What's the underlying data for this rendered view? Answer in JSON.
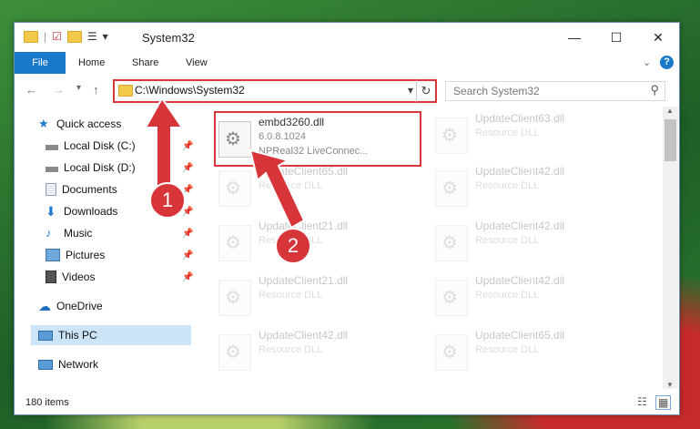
{
  "window": {
    "title": "System32"
  },
  "titlebar": {
    "minimize": "—",
    "maximize": "☐",
    "close": "✕",
    "qat_dropdown": "▾"
  },
  "ribbon": {
    "tabs": [
      "File",
      "Home",
      "Share",
      "View"
    ],
    "expand": "⌄",
    "help": "?"
  },
  "nav": {
    "back": "←",
    "forward": "→",
    "recent": "▾",
    "up": "↑"
  },
  "address": {
    "path": "C:\\Windows\\System32",
    "dropdown": "▾",
    "refresh": "↻"
  },
  "search": {
    "placeholder": "Search System32",
    "icon": "⚲"
  },
  "sidebar": {
    "items": [
      {
        "label": "Quick access",
        "icon": "star-icon"
      },
      {
        "label": "Local Disk (C:)",
        "icon": "drive-icon",
        "pinned": true
      },
      {
        "label": "Local Disk (D:)",
        "icon": "drive-icon",
        "pinned": true
      },
      {
        "label": "Documents",
        "icon": "documents-icon",
        "pinned": true
      },
      {
        "label": "Downloads",
        "icon": "downloads-icon",
        "pinned": true
      },
      {
        "label": "Music",
        "icon": "music-icon",
        "pinned": true
      },
      {
        "label": "Pictures",
        "icon": "pictures-icon",
        "pinned": true
      },
      {
        "label": "Videos",
        "icon": "videos-icon",
        "pinned": true
      },
      {
        "label": "OneDrive",
        "icon": "cloud-icon"
      },
      {
        "label": "This PC",
        "icon": "pc-icon"
      },
      {
        "label": "Network",
        "icon": "network-icon"
      }
    ]
  },
  "files": {
    "highlighted": {
      "name": "embd3260.dll",
      "version": "6.0.8.1024",
      "description": "NPReal32 LiveConnec..."
    },
    "left_column": [
      {
        "name": "UpdateClient65.dll",
        "type": "Resource DLL"
      },
      {
        "name": "UpdateClient21.dll",
        "type": "Resource DLL"
      },
      {
        "name": "UpdateClient21.dll",
        "type": "Resource DLL"
      },
      {
        "name": "UpdateClient42.dll",
        "type": "Resource DLL"
      }
    ],
    "right_column": [
      {
        "name": "UpdateClient63.dll",
        "type": "Resource DLL"
      },
      {
        "name": "UpdateClient42.dll",
        "type": "Resource DLL"
      },
      {
        "name": "UpdateClient42.dll",
        "type": "Resource DLL"
      },
      {
        "name": "UpdateClient42.dll",
        "type": "Resource DLL"
      },
      {
        "name": "UpdateClient65.dll",
        "type": "Resource DLL"
      }
    ]
  },
  "status": {
    "count": "180 items"
  },
  "annotations": {
    "one": "1",
    "two": "2"
  },
  "colors": {
    "accent": "#1979ca",
    "highlight": "#d9373a"
  }
}
